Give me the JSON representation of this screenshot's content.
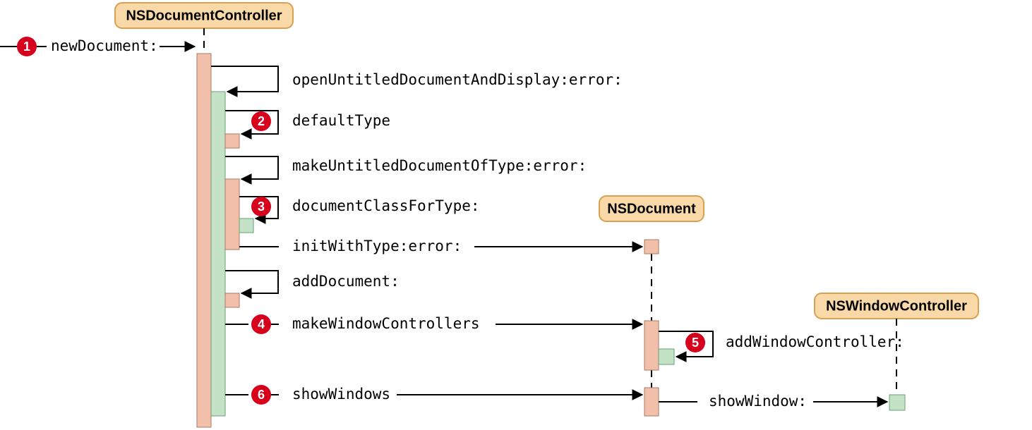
{
  "diagram": {
    "classes": {
      "controller": "NSDocumentController",
      "document": "NSDocument",
      "window": "NSWindowController"
    },
    "steps": {
      "s1": "1",
      "s2": "2",
      "s3": "3",
      "s4": "4",
      "s5": "5",
      "s6": "6"
    },
    "messages": {
      "newDocument": "newDocument:",
      "openUntitled": "openUntitledDocumentAndDisplay:error:",
      "defaultType": "defaultType",
      "makeUntitled": "makeUntitledDocumentOfType:error:",
      "docClassForType": "documentClassForType:",
      "initWithType": "initWithType:error:",
      "addDocument": "addDocument:",
      "makeWinCtrls": "makeWindowControllers",
      "addWinCtrl": "addWindowController:",
      "showWindows": "showWindows",
      "showWindow": "showWindow:"
    }
  }
}
